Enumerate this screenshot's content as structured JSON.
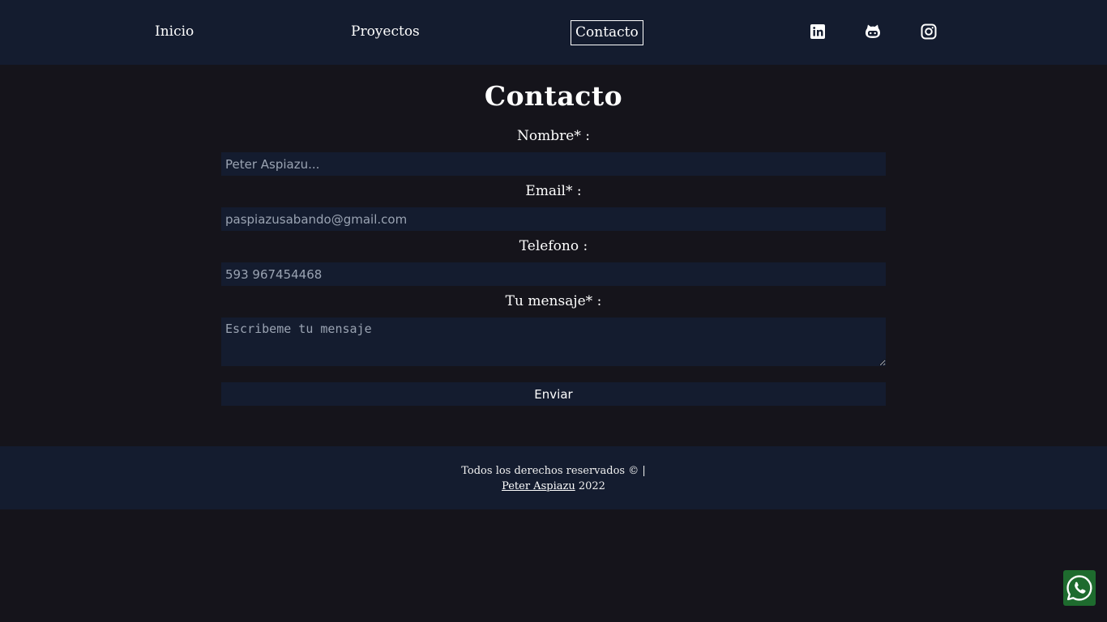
{
  "nav": {
    "inicio": "Inicio",
    "proyectos": "Proyectos",
    "contacto": "Contacto",
    "social": [
      "linkedin-icon",
      "github-icon",
      "instagram-icon"
    ]
  },
  "page": {
    "title": "Contacto"
  },
  "form": {
    "name_label": "Nombre* :",
    "name_placeholder": "Peter Aspiazu...",
    "email_label": "Email* :",
    "email_placeholder": "paspiazusabando@gmail.com",
    "phone_label": "Telefono :",
    "phone_placeholder": "593 967454468",
    "message_label": "Tu mensaje* :",
    "message_placeholder": "Escribeme tu mensaje",
    "submit_label": "Enviar"
  },
  "footer": {
    "rights": "Todos los derechos reservados © |",
    "author": "Peter Aspiazu",
    "year": "2022"
  },
  "floating": {
    "whatsapp_icon": "whatsapp-icon"
  },
  "colors": {
    "background": "#15141b",
    "panel": "#141c2f",
    "whatsapp": "#1e6b2e"
  }
}
